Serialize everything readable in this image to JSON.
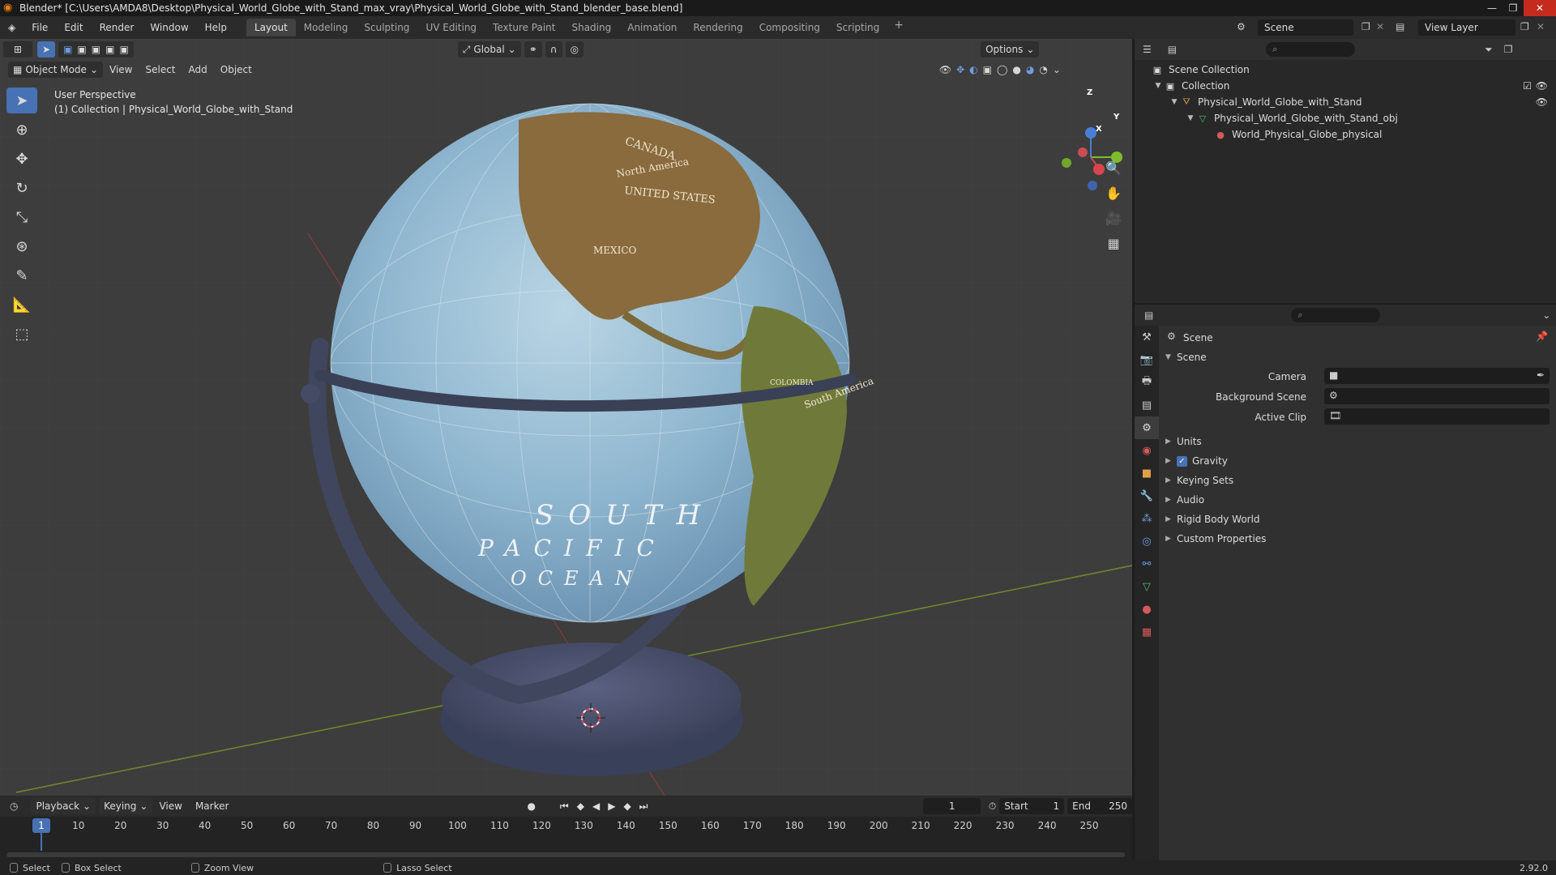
{
  "window": {
    "title": "Blender* [C:\\Users\\AMDA8\\Desktop\\Physical_World_Globe_with_Stand_max_vray\\Physical_World_Globe_with_Stand_blender_base.blend]",
    "minimize": "—",
    "maximize": "❐",
    "close": "✕"
  },
  "menus": [
    "File",
    "Edit",
    "Render",
    "Window",
    "Help"
  ],
  "workspaces": [
    "Layout",
    "Modeling",
    "Sculpting",
    "UV Editing",
    "Texture Paint",
    "Shading",
    "Animation",
    "Rendering",
    "Compositing",
    "Scripting"
  ],
  "workspace_active": "Layout",
  "workspace_add": "+",
  "scene_name": "Scene",
  "view_layer": "View Layer",
  "viewport": {
    "mode": "Object Mode",
    "menus": [
      "View",
      "Select",
      "Add",
      "Object"
    ],
    "transform_orientation": "Global",
    "options": "Options",
    "info_line1": "User Perspective",
    "info_line2": "(1) Collection | Physical_World_Globe_with_Stand",
    "gizmo": {
      "x": "X",
      "y": "Y",
      "z": "Z"
    },
    "globe_labels": {
      "canada": "CANADA",
      "north_america": "North America",
      "united_states": "UNITED STATES",
      "mexico": "MEXICO",
      "colombia": "COLOMBIA",
      "south_america": "South America",
      "ocean1": "SOUTH",
      "ocean2": "PACIFIC",
      "ocean3": "OCEAN"
    }
  },
  "outliner": {
    "root": "Scene Collection",
    "items": [
      {
        "label": "Collection",
        "icon": "collection-icon"
      },
      {
        "label": "Physical_World_Globe_with_Stand",
        "icon": "object-icon"
      },
      {
        "label": "Physical_World_Globe_with_Stand_obj",
        "icon": "mesh-icon"
      },
      {
        "label": "World_Physical_Globe_physical",
        "icon": "material-icon"
      }
    ]
  },
  "properties": {
    "context": "Scene",
    "panel_title": "Scene",
    "fields": [
      {
        "label": "Camera"
      },
      {
        "label": "Background Scene"
      },
      {
        "label": "Active Clip"
      }
    ],
    "panels": [
      "Units",
      "Gravity",
      "Keying Sets",
      "Audio",
      "Rigid Body World",
      "Custom Properties"
    ],
    "gravity_checked": true
  },
  "timeline": {
    "menus": [
      "Playback",
      "Keying",
      "View",
      "Marker"
    ],
    "current_frame": "1",
    "start_label": "Start",
    "start": "1",
    "end_label": "End",
    "end": "250",
    "ticks": [
      "10",
      "20",
      "30",
      "40",
      "50",
      "60",
      "70",
      "80",
      "90",
      "100",
      "110",
      "120",
      "130",
      "140",
      "150",
      "160",
      "170",
      "180",
      "190",
      "200",
      "210",
      "220",
      "230",
      "240",
      "250"
    ],
    "playhead": "1"
  },
  "status": {
    "select": "Select",
    "box_select": "Box Select",
    "zoom_view": "Zoom View",
    "lasso_select": "Lasso Select",
    "version": "2.92.0"
  },
  "colors": {
    "accent": "#4772b3",
    "ocean": "#8fb6cf",
    "stand": "#4a5069",
    "land": "#8a6b3d"
  }
}
